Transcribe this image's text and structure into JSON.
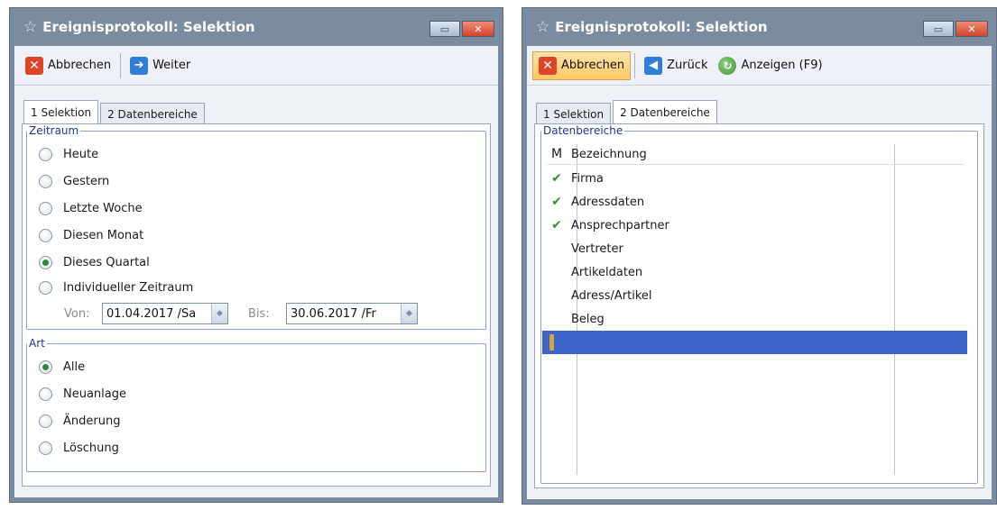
{
  "left": {
    "title": "Ereignisprotokoll: Selektion",
    "toolbar": {
      "cancel_label": "Abbrechen",
      "next_label": "Weiter"
    },
    "tabs": [
      "1 Selektion",
      "2 Datenbereiche"
    ],
    "zeitraum": {
      "legend": "Zeitraum",
      "options": [
        "Heute",
        "Gestern",
        "Letzte Woche",
        "Diesen Monat",
        "Dieses Quartal",
        "Individueller Zeitraum"
      ],
      "selected": "Dieses Quartal",
      "von_label": "Von:",
      "von_value": "01.04.2017 /Sa",
      "bis_label": "Bis:",
      "bis_value": "30.06.2017 /Fr"
    },
    "art": {
      "legend": "Art",
      "options": [
        "Alle",
        "Neuanlage",
        "Änderung",
        "Löschung"
      ],
      "selected": "Alle"
    }
  },
  "right": {
    "title": "Ereignisprotokoll: Selektion",
    "toolbar": {
      "cancel_label": "Abbrechen",
      "back_label": "Zurück",
      "show_label": "Anzeigen (F9)"
    },
    "tabs": [
      "1 Selektion",
      "2 Datenbereiche"
    ],
    "datenbereiche": {
      "legend": "Datenbereiche",
      "col_m": "M",
      "col_name": "Bezeichnung",
      "rows": [
        {
          "checked": true,
          "name": "Firma"
        },
        {
          "checked": true,
          "name": "Adressdaten"
        },
        {
          "checked": true,
          "name": "Ansprechpartner"
        },
        {
          "checked": false,
          "name": "Vertreter"
        },
        {
          "checked": false,
          "name": "Artikeldaten"
        },
        {
          "checked": false,
          "name": "Adress/Artikel"
        },
        {
          "checked": false,
          "name": "Beleg"
        }
      ]
    }
  },
  "colors": {
    "title_bg": "#7b8ca0",
    "selection": "#3d64c8",
    "check": "#2a9a2a",
    "accent_orange": "#ffc864"
  }
}
